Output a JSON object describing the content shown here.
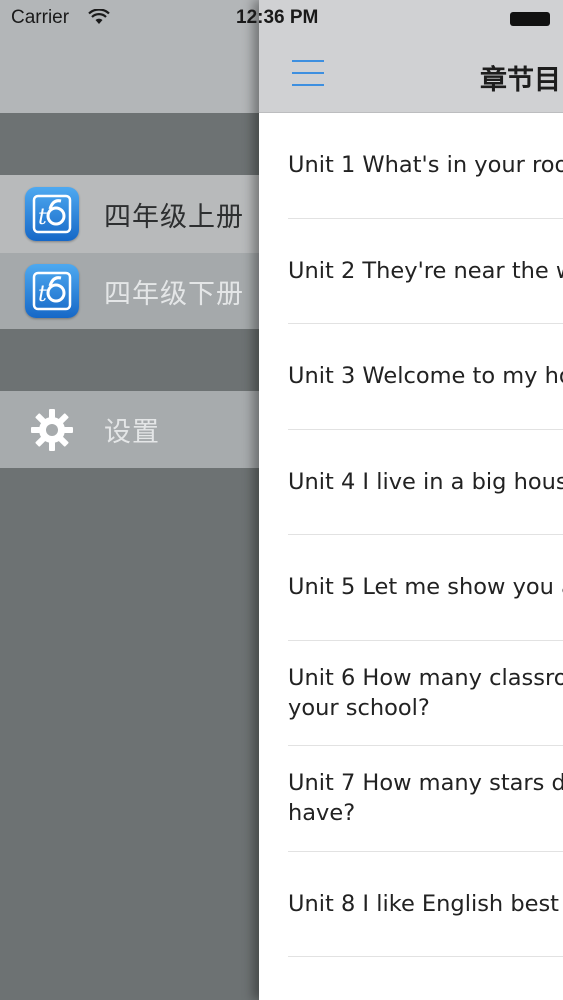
{
  "status_bar": {
    "carrier": "Carrier",
    "time": "12:36 PM"
  },
  "sidebar": {
    "items": [
      {
        "label": "四年级上册",
        "icon": "textbook-app-icon"
      },
      {
        "label": "四年级下册",
        "icon": "textbook-app-icon"
      }
    ],
    "settings_label": "设置"
  },
  "navbar": {
    "title": "章节目"
  },
  "units": [
    {
      "line1": "Unit 1 What's in your roo",
      "line2": ""
    },
    {
      "line1": "Unit 2 They're near the w",
      "line2": ""
    },
    {
      "line1": "Unit 3 Welcome to my ho",
      "line2": ""
    },
    {
      "line1": "Unit 4 I live in a big hous",
      "line2": ""
    },
    {
      "line1": "Unit 5 Let me show you a",
      "line2": ""
    },
    {
      "line1": "Unit 6 How many classro",
      "line2": "your school?"
    },
    {
      "line1": "Unit 7 How many stars d",
      "line2": "have?"
    },
    {
      "line1": "Unit 8 I like English best",
      "line2": ""
    }
  ],
  "colors": {
    "accent": "#3d8fe0",
    "sidebar_bg": "#6d7273",
    "navbar_bg": "#d0d1d3"
  }
}
